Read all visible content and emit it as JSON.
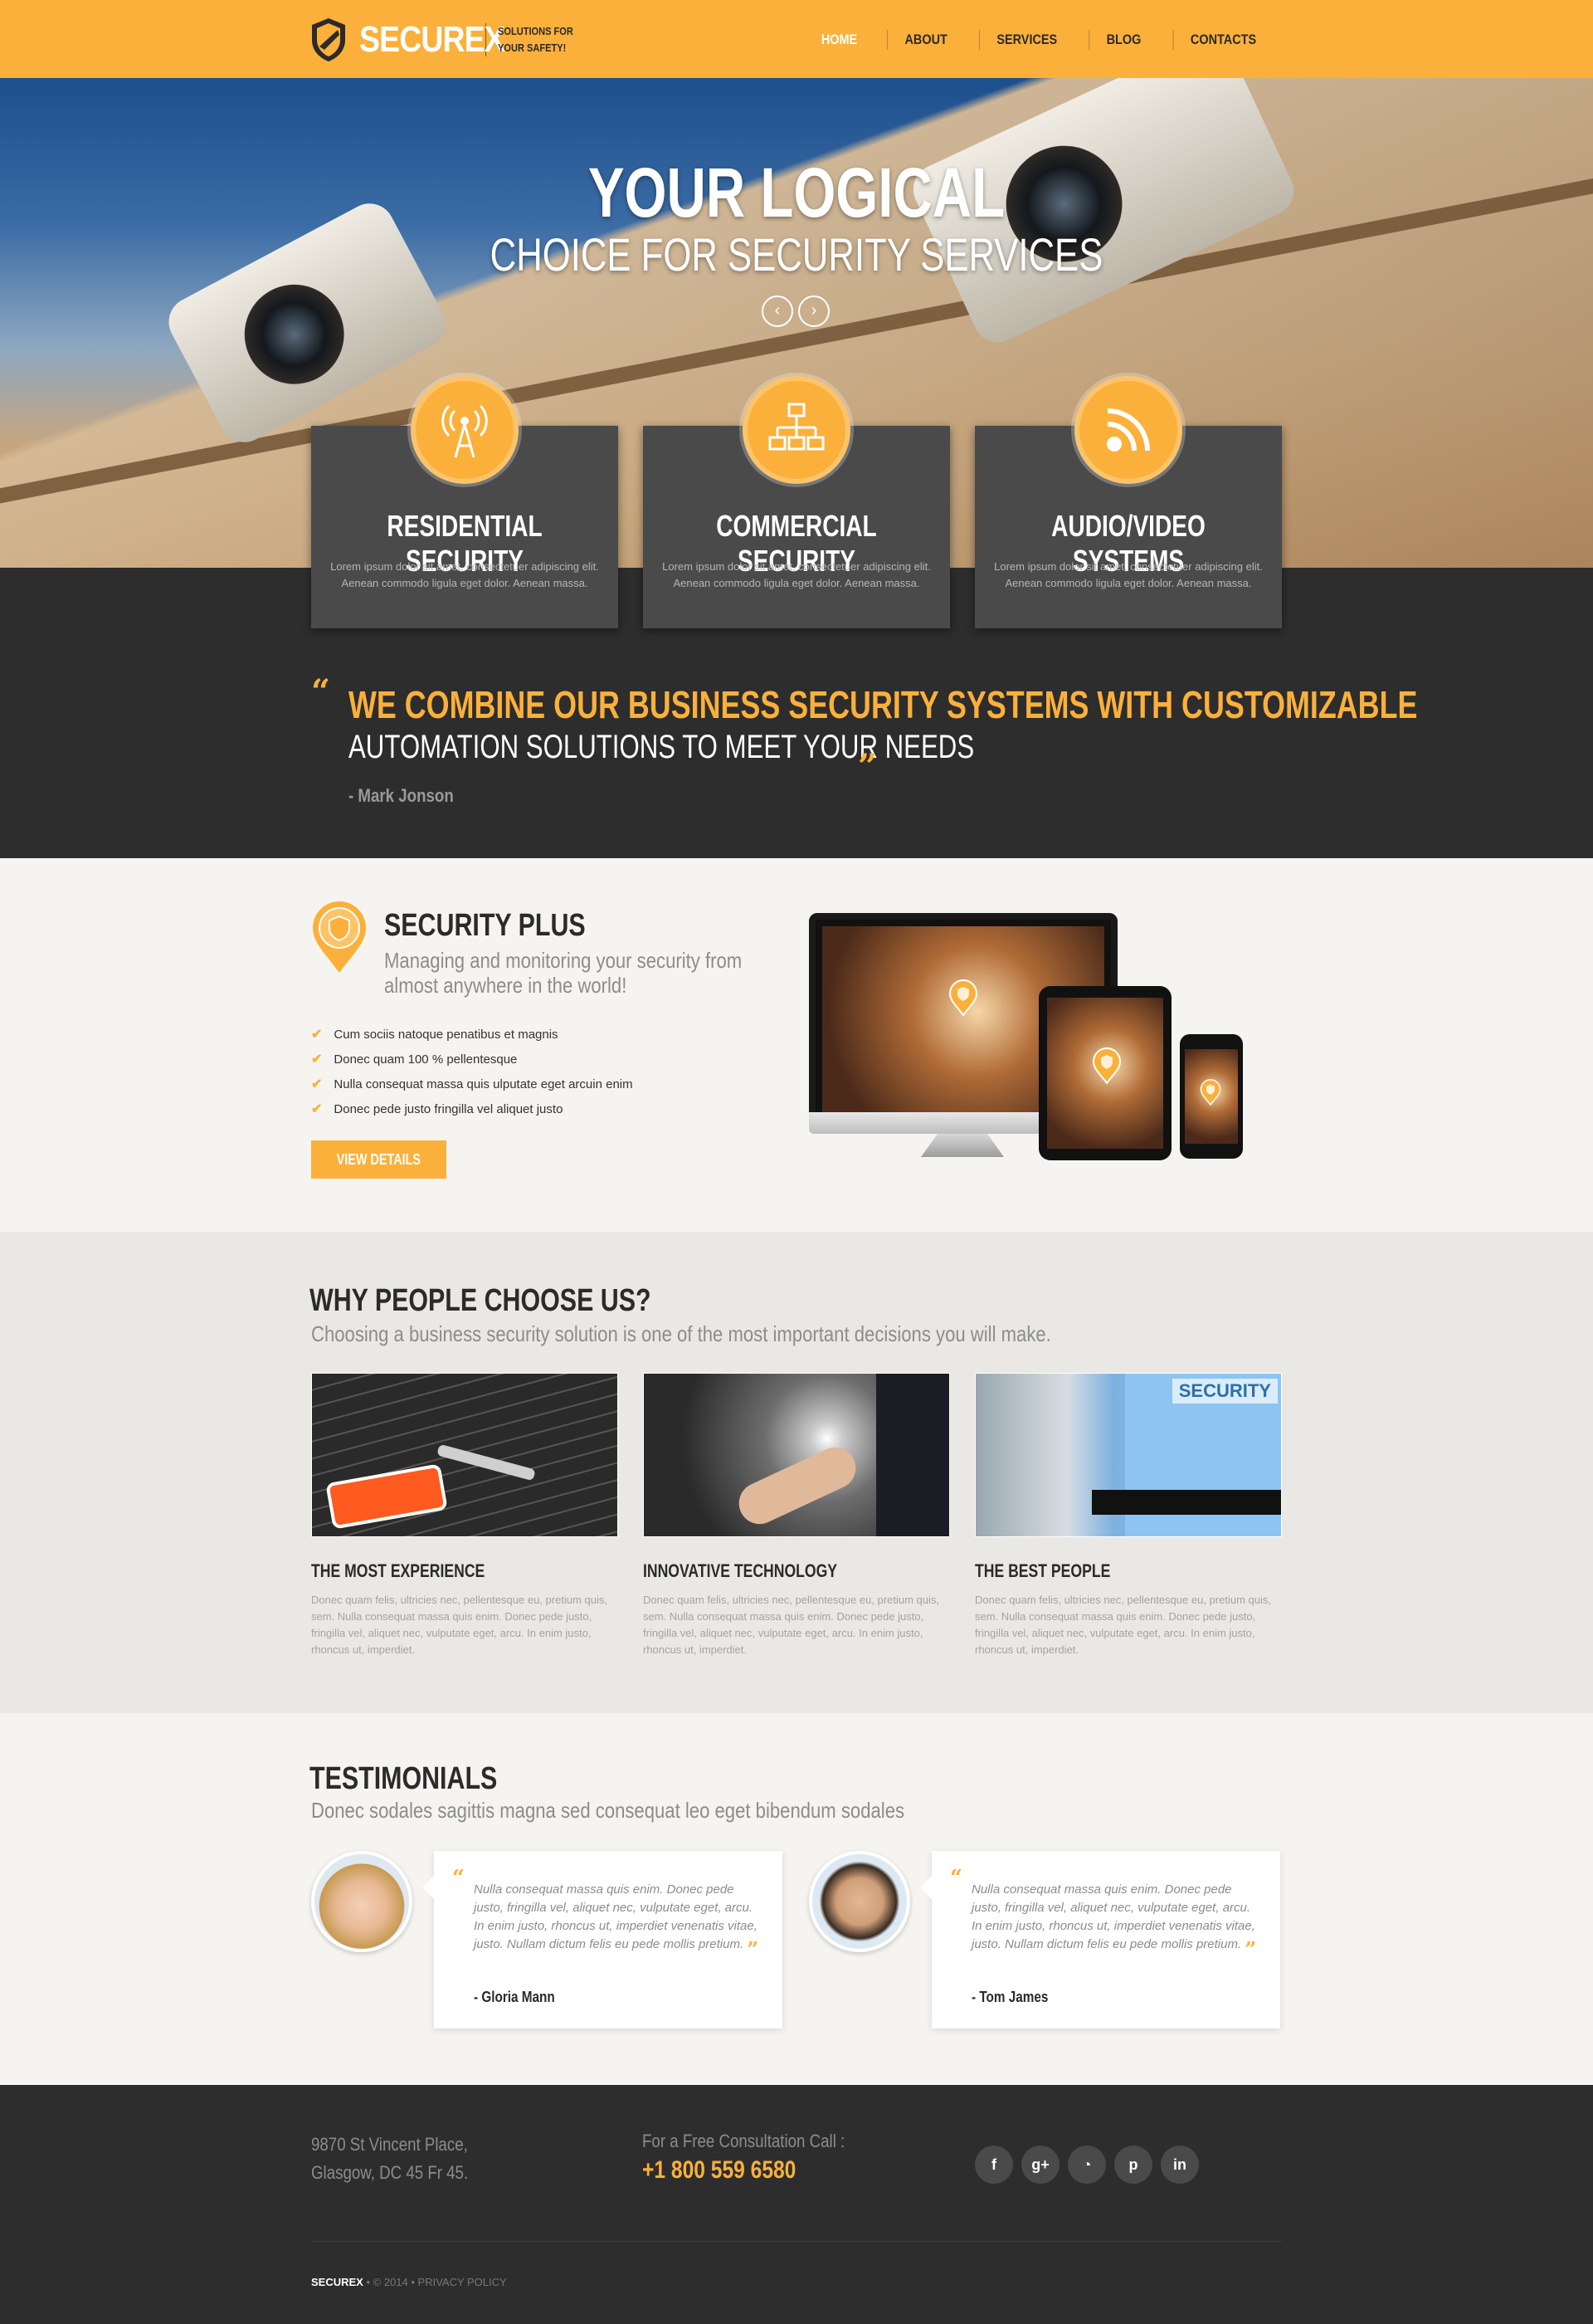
{
  "header": {
    "brand": "SECUREX",
    "tagline": "SOLUTIONS FOR YOUR SAFETY!",
    "nav": [
      "HOME",
      "ABOUT",
      "SERVICES",
      "BLOG",
      "CONTACTS"
    ],
    "active_nav": "HOME",
    "accent_color": "#fbb03b"
  },
  "hero": {
    "title": "YOUR LOGICAL",
    "subtitle": "CHOICE FOR SECURITY SERVICES",
    "prev_icon": "chevron-left-icon",
    "next_icon": "chevron-right-icon"
  },
  "services": [
    {
      "icon": "antenna-icon",
      "title": "RESIDENTIAL SECURITY",
      "text": "Lorem ipsum dolor sit amet, consectetuer adipiscing elit. Aenean commodo ligula eget dolor. Aenean massa."
    },
    {
      "icon": "network-icon",
      "title": "COMMERCIAL SECURITY",
      "text": "Lorem ipsum dolor sit amet, consectetuer adipiscing elit. Aenean commodo ligula eget dolor. Aenean massa."
    },
    {
      "icon": "rss-icon",
      "title": "AUDIO/VIDEO SYSTEMS",
      "text": "Lorem ipsum dolor sit amet, consectetuer adipiscing elit. Aenean commodo ligula eget dolor. Aenean massa."
    }
  ],
  "quote": {
    "open": "“",
    "close": "”",
    "line1": "WE COMBINE OUR BUSINESS SECURITY SYSTEMS WITH CUSTOMIZABLE",
    "line2": "AUTOMATION SOLUTIONS TO MEET YOUR NEEDS",
    "author": "- Mark Jonson"
  },
  "security_plus": {
    "title": "SECURITY PLUS",
    "subtitle": "Managing and monitoring your security from almost anywhere in the world!",
    "items": [
      "Cum sociis natoque penatibus et magnis",
      "Donec quam 100 % pellentesque",
      "Nulla consequat massa quis ulputate eget arcuin enim",
      "Donec pede justo fringilla vel aliquet justo"
    ],
    "button": "VIEW DETAILS"
  },
  "why": {
    "title": "WHY PEOPLE CHOOSE US?",
    "subtitle": "Choosing a business security solution is one of the most important decisions you will make.",
    "features": [
      {
        "image": "keyboard-key-image",
        "title": "THE MOST EXPERIENCE",
        "text": "Donec quam felis, ultricies nec, pellentesque eu, pretium quis, sem. Nulla consequat massa quis enim. Donec pede justo, fringilla vel, aliquet nec, vulputate eget, arcu. In enim justo, rhoncus ut, imperdiet."
      },
      {
        "image": "touch-technology-image",
        "title": "INNOVATIVE TECHNOLOGY",
        "text": "Donec quam felis, ultricies nec, pellentesque eu, pretium quis, sem. Nulla consequat massa quis enim. Donec pede justo, fringilla vel, aliquet nec, vulputate eget, arcu. In enim justo, rhoncus ut, imperdiet."
      },
      {
        "image": "security-guard-image",
        "badge": "SECURITY",
        "title": "THE BEST PEOPLE",
        "text": "Donec quam felis, ultricies nec, pellentesque eu, pretium quis, sem. Nulla consequat massa quis enim. Donec pede justo, fringilla vel, aliquet nec, vulputate eget, arcu. In enim justo, rhoncus ut, imperdiet."
      }
    ]
  },
  "testimonials": {
    "title": "TESTIMONIALS",
    "subtitle": "Donec sodales sagittis magna sed consequat leo eget bibendum sodales",
    "items": [
      {
        "text": "Nulla consequat massa quis enim. Donec pede justo, fringilla vel, aliquet nec, vulputate eget, arcu. In enim justo, rhoncus ut, imperdiet venenatis vitae, justo. Nullam dictum felis eu pede mollis pretium.",
        "author": "- Gloria Mann"
      },
      {
        "text": "Nulla consequat massa quis enim. Donec pede justo, fringilla vel, aliquet nec, vulputate eget, arcu. In enim justo, rhoncus ut, imperdiet venenatis vitae, justo. Nullam dictum felis eu pede mollis pretium.",
        "author": "- Tom James"
      }
    ]
  },
  "footer": {
    "address_line1": "9870 St Vincent Place,",
    "address_line2": "Glasgow, DC 45 Fr 45.",
    "call_label": "For a Free Consultation Call :",
    "phone": "+1 800 559 6580",
    "socials": [
      {
        "icon": "facebook-icon",
        "glyph": "f"
      },
      {
        "icon": "google-plus-icon",
        "glyph": "g+"
      },
      {
        "icon": "rss-icon",
        "glyph": "◔"
      },
      {
        "icon": "pinterest-icon",
        "glyph": "p"
      },
      {
        "icon": "linkedin-icon",
        "glyph": "in"
      }
    ],
    "copyright_brand": "SECUREX",
    "copyright_rest": " • © 2014 • PRIVACY POLICY"
  }
}
